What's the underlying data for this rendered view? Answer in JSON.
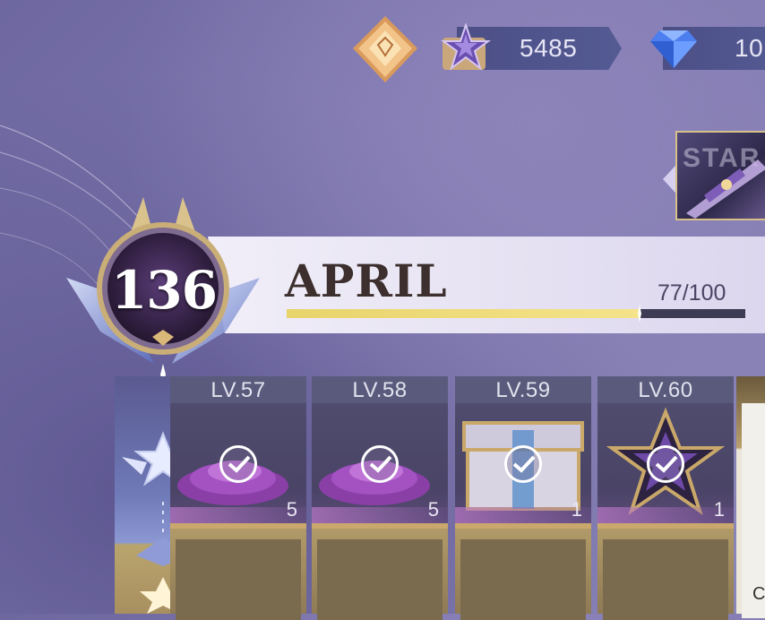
{
  "header": {
    "currency": [
      {
        "name": "star-token",
        "value": "5485",
        "icon": "star-token-icon"
      },
      {
        "name": "diamond",
        "value": "10",
        "icon": "diamond-icon"
      }
    ]
  },
  "side_banner": {
    "text": "STAR"
  },
  "season": {
    "level": "136",
    "month": "APRIL",
    "progress_text": "77/100",
    "progress": 0.77
  },
  "rewards": [
    {
      "level_label": "LV.57",
      "count": "5",
      "item_icon": "crystal-pile-icon",
      "claimed": true
    },
    {
      "level_label": "LV.58",
      "count": "5",
      "item_icon": "crystal-pile-icon",
      "claimed": true
    },
    {
      "level_label": "LV.59",
      "count": "1",
      "item_icon": "treasure-chest-icon",
      "claimed": true
    },
    {
      "level_label": "LV.60",
      "count": "1",
      "item_icon": "star-emblem-icon",
      "claimed": true
    }
  ],
  "right_edge_text": "C",
  "colors": {
    "accent_gold": "#e8d46b",
    "panel_light": "#ece8f6",
    "title_brown": "#3c2f2d"
  }
}
